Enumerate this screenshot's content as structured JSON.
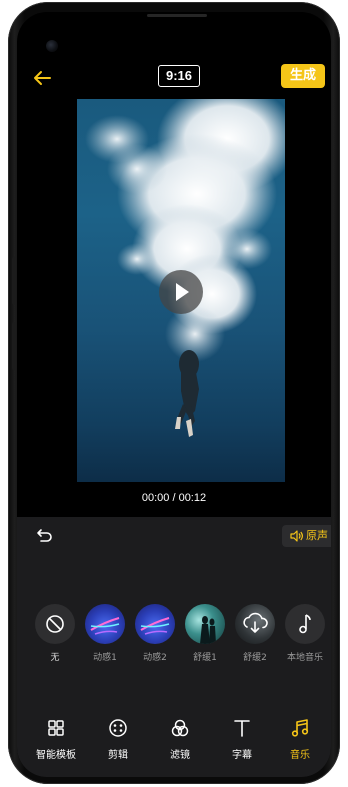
{
  "top_bar": {
    "back_icon": "arrow-left-icon",
    "aspect_ratio": "9:16",
    "generate_label": "生成"
  },
  "player": {
    "play_icon": "play-icon",
    "timecode": "00:00 / 00:12"
  },
  "music_panel": {
    "undo_icon": "undo-icon",
    "original_audio_label": "原声",
    "items": [
      {
        "label": "无",
        "icon": "prohibit-icon"
      },
      {
        "label": "动感1",
        "icon": "music-thumb-dynamic-1"
      },
      {
        "label": "动感2",
        "icon": "music-thumb-dynamic-2"
      },
      {
        "label": "舒缓1",
        "icon": "music-thumb-soothing-1"
      },
      {
        "label": "舒缓2",
        "icon": "music-thumb-soothing-2-download"
      },
      {
        "label": "本地音乐",
        "icon": "music-note-icon"
      }
    ]
  },
  "tabs": [
    {
      "label": "智能模板",
      "icon": "grid-icon",
      "active": false
    },
    {
      "label": "剪辑",
      "icon": "scissors-icon",
      "active": false
    },
    {
      "label": "滤镜",
      "icon": "filter-icon",
      "active": false
    },
    {
      "label": "字幕",
      "icon": "text-icon",
      "active": false
    },
    {
      "label": "音乐",
      "icon": "music-icon",
      "active": true
    }
  ],
  "colors": {
    "accent": "#f5c518",
    "panel_bg": "#1c1c1e",
    "screen_bg": "#000000"
  }
}
